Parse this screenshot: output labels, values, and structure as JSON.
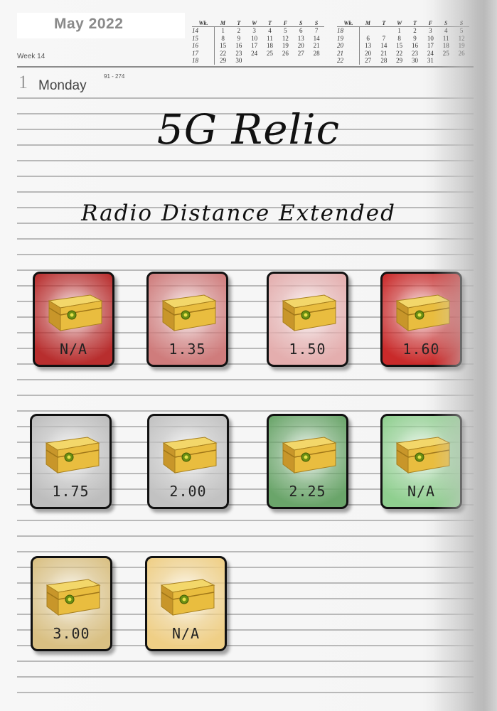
{
  "header": {
    "month_title": "May 2022",
    "week_label": "Week 14",
    "day_number": "1",
    "day_name": "Monday",
    "day_range": "91 - 274"
  },
  "mini_calendars": [
    {
      "headers": [
        "Wk.",
        "M",
        "T",
        "W",
        "T",
        "F",
        "S",
        "S"
      ],
      "rows": [
        [
          "14",
          "1",
          "2",
          "3",
          "4",
          "5",
          "6",
          "7"
        ],
        [
          "15",
          "8",
          "9",
          "10",
          "11",
          "12",
          "13",
          "14"
        ],
        [
          "16",
          "15",
          "16",
          "17",
          "18",
          "19",
          "20",
          "21"
        ],
        [
          "17",
          "22",
          "23",
          "24",
          "25",
          "26",
          "27",
          "28"
        ],
        [
          "18",
          "29",
          "30",
          "",
          "",
          "",
          "",
          ""
        ]
      ]
    },
    {
      "headers": [
        "Wk.",
        "M",
        "T",
        "W",
        "T",
        "F",
        "S",
        "S"
      ],
      "rows": [
        [
          "18",
          "",
          "",
          "1",
          "2",
          "3",
          "4",
          "5"
        ],
        [
          "19",
          "6",
          "7",
          "8",
          "9",
          "10",
          "11",
          "12"
        ],
        [
          "20",
          "13",
          "14",
          "15",
          "16",
          "17",
          "18",
          "19"
        ],
        [
          "21",
          "20",
          "21",
          "22",
          "23",
          "24",
          "25",
          "26"
        ],
        [
          "22",
          "27",
          "28",
          "29",
          "30",
          "31",
          "",
          ""
        ]
      ]
    }
  ],
  "title": "5G Relic",
  "subtitle": "Radio Distance Extended",
  "cards": [
    {
      "value": "N/A",
      "color": "#b82e2e"
    },
    {
      "value": "1.35",
      "color": "#cf7c7c"
    },
    {
      "value": "1.50",
      "color": "#e4aeae"
    },
    {
      "value": "1.60",
      "color": "#c92a2a"
    },
    {
      "value": "1.75",
      "color": "#bdbdbd"
    },
    {
      "value": "2.00",
      "color": "#c2c2c2"
    },
    {
      "value": "2.25",
      "color": "#6aa56a"
    },
    {
      "value": "N/A",
      "color": "#8fcf8f"
    },
    {
      "value": "3.00",
      "color": "#d9c083"
    },
    {
      "value": "N/A",
      "color": "#efcf86"
    }
  ]
}
